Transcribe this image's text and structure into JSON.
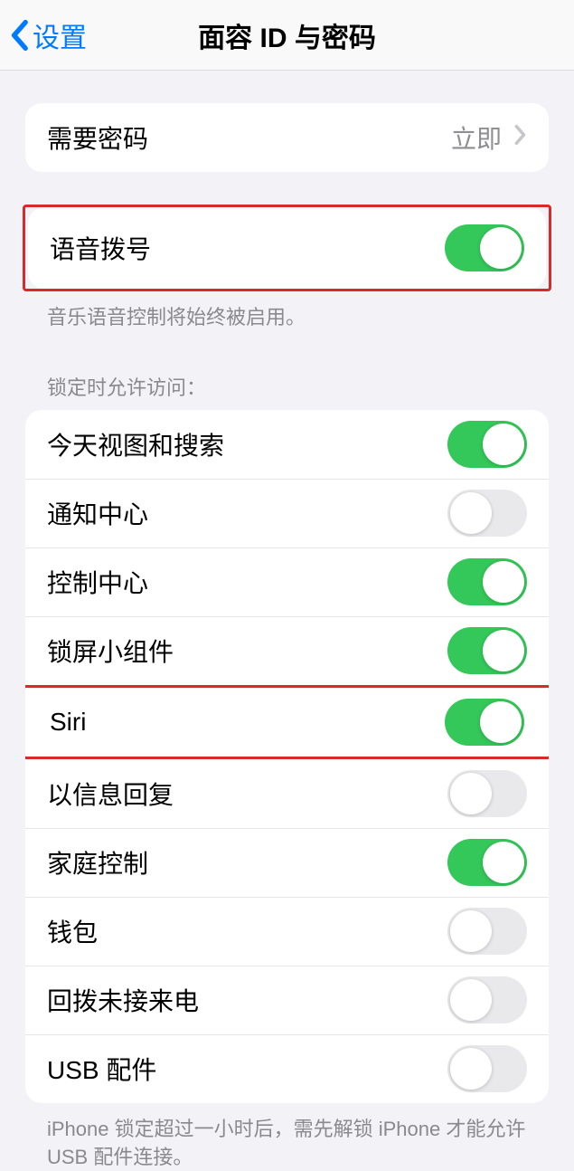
{
  "nav": {
    "back_label": "设置",
    "title": "面容 ID 与密码"
  },
  "require_passcode": {
    "label": "需要密码",
    "value": "立即"
  },
  "voice_dial": {
    "label": "语音拨号",
    "on": true,
    "footer": "音乐语音控制将始终被启用。"
  },
  "lock_access": {
    "header": "锁定时允许访问：",
    "items": [
      {
        "label": "今天视图和搜索",
        "on": true
      },
      {
        "label": "通知中心",
        "on": false
      },
      {
        "label": "控制中心",
        "on": true
      },
      {
        "label": "锁屏小组件",
        "on": true
      },
      {
        "label": "Siri",
        "on": true
      },
      {
        "label": "以信息回复",
        "on": false
      },
      {
        "label": "家庭控制",
        "on": true
      },
      {
        "label": "钱包",
        "on": false
      },
      {
        "label": "回拨未接来电",
        "on": false
      },
      {
        "label": "USB 配件",
        "on": false
      }
    ],
    "footer": "iPhone 锁定超过一小时后，需先解锁 iPhone 才能允许 USB 配件连接。"
  }
}
